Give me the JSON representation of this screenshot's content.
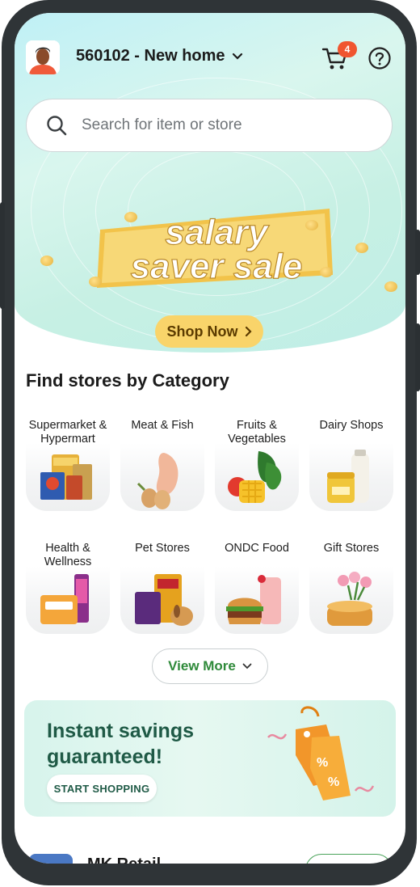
{
  "header": {
    "location": "560102 - New home",
    "cart_count": "4"
  },
  "search": {
    "placeholder": "Search for item or store"
  },
  "banner": {
    "line1": "salary",
    "line2": "saver sale",
    "cta": "Shop Now"
  },
  "categories": {
    "title": "Find stores by Category",
    "items": [
      {
        "label": "Supermarket & Hypermart",
        "icon": "grocery-packs-icon"
      },
      {
        "label": "Meat & Fish",
        "icon": "chicken-eggs-icon"
      },
      {
        "label": "Fruits & Vegetables",
        "icon": "mango-spinach-icon"
      },
      {
        "label": "Dairy Shops",
        "icon": "milk-ghee-icon"
      },
      {
        "label": "Health & Wellness",
        "icon": "health-products-icon"
      },
      {
        "label": "Pet Stores",
        "icon": "pet-food-dog-icon"
      },
      {
        "label": "ONDC Food",
        "icon": "burger-shake-icon"
      },
      {
        "label": "Gift Stores",
        "icon": "cake-flowers-icon"
      }
    ],
    "view_more": "View More"
  },
  "promo": {
    "title": "Instant savings guaranteed!",
    "cta": "START SHOPPING"
  },
  "store": {
    "name": "MK Retail"
  },
  "colors": {
    "accent_green": "#2f8a3a",
    "badge": "#f0552f",
    "shop_now": "#f9d46a",
    "promo_text": "#1f5a46"
  }
}
